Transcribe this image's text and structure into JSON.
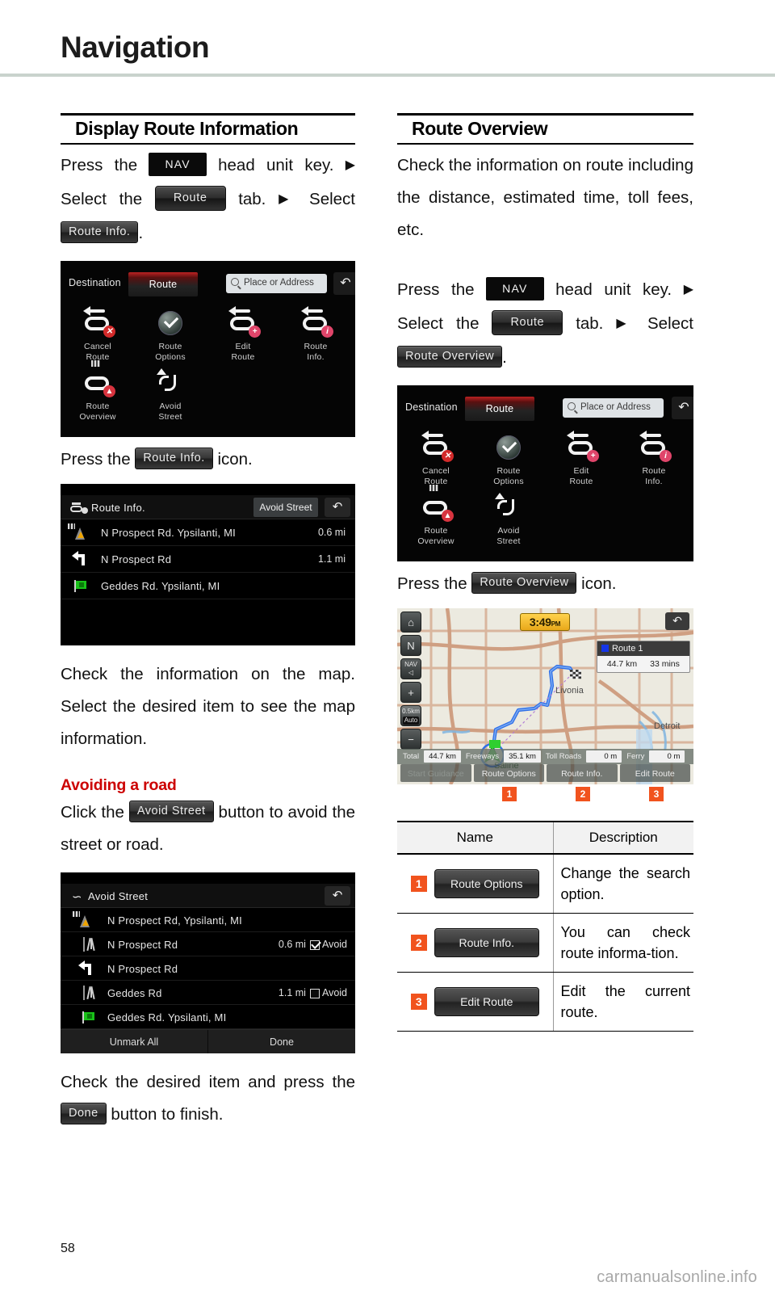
{
  "page": {
    "title": "Navigation",
    "number": "58",
    "watermark": "carmanualsonline.info"
  },
  "left": {
    "heading": "Display Route Information",
    "step1": {
      "pre": "Press the",
      "nav_key": "NAV",
      "mid": "head unit key.",
      "arrow": "▶",
      "select": "Select   the",
      "route_tab": "Route",
      "tab_word": "tab.",
      "arrow2": "▶",
      "select2": "Select",
      "route_info_chip": "Route Info.",
      "period": "."
    },
    "nav_screenshot": {
      "tab_destination": "Destination",
      "tab_route": "Route",
      "search_placeholder": "Place or Address",
      "back_glyph": "↶",
      "items": [
        {
          "label_line1": "Cancel",
          "label_line2": "Route"
        },
        {
          "label_line1": "Route",
          "label_line2": "Options"
        },
        {
          "label_line1": "Edit",
          "label_line2": "Route"
        },
        {
          "label_line1": "Route",
          "label_line2": "Info."
        },
        {
          "label_line1": "Route",
          "label_line2": "Overview"
        },
        {
          "label_line1": "Avoid",
          "label_line2": "Street"
        }
      ]
    },
    "caption1": {
      "pre": "Press the",
      "chip": "Route Info.",
      "post": "icon."
    },
    "route_info_screen": {
      "title": "Route Info.",
      "avoid_button": "Avoid Street",
      "back_glyph": "↶",
      "rows": [
        {
          "icon": "start-road-icon",
          "name": "N Prospect Rd. Ypsilanti, MI",
          "distance": "0.6 mi"
        },
        {
          "icon": "turn-left-icon",
          "name": "N Prospect Rd",
          "distance": "1.1 mi"
        },
        {
          "icon": "finish-flag-icon",
          "name": "Geddes Rd. Ypsilanti, MI",
          "distance": ""
        }
      ]
    },
    "para2": "Check the information on the map. Select the desired item to see the map information.",
    "subhead": "Avoiding a road",
    "para3": {
      "pre": "Click the",
      "chip": "Avoid Street",
      "post": "button to avoid the street or road."
    },
    "avoid_screen": {
      "title": "Avoid Street",
      "back_glyph": "↶",
      "rows": [
        {
          "icon": "start-road-icon",
          "name": "N Prospect Rd, Ypsilanti, MI",
          "distance": "",
          "checkbox": "none",
          "avoid_label": ""
        },
        {
          "icon": "lane-icon",
          "name": "N Prospect Rd",
          "distance": "0.6 mi",
          "checkbox": "checked",
          "avoid_label": "Avoid"
        },
        {
          "icon": "turn-left-icon",
          "name": "N Prospect Rd",
          "distance": "",
          "checkbox": "none",
          "avoid_label": ""
        },
        {
          "icon": "lane-icon",
          "name": "Geddes Rd",
          "distance": "1.1 mi",
          "checkbox": "unchecked",
          "avoid_label": "Avoid"
        },
        {
          "icon": "finish-flag-icon",
          "name": "Geddes Rd. Ypsilanti, MI",
          "distance": "",
          "checkbox": "none",
          "avoid_label": ""
        }
      ],
      "footer": {
        "unmark": "Unmark All",
        "done": "Done"
      }
    },
    "para4": {
      "pre": "Check the desired item and press the",
      "chip": "Done",
      "post": "button to finish."
    }
  },
  "right": {
    "heading": "Route Overview",
    "intro": "Check the information on route including the distance, estimated time, toll fees, etc.",
    "step1": {
      "pre": "Press the",
      "nav_key": "NAV",
      "mid": "head unit key.",
      "arrow": "▶",
      "select": "Select   the",
      "route_tab": "Route",
      "tab_word": "tab.",
      "arrow2": "▶",
      "select2": "Select",
      "route_overview_chip": "Route Overview",
      "period": "."
    },
    "nav_screenshot": {
      "tab_destination": "Destination",
      "tab_route": "Route",
      "search_placeholder": "Place or Address",
      "back_glyph": "↶",
      "items": [
        {
          "label_line1": "Cancel",
          "label_line2": "Route"
        },
        {
          "label_line1": "Route",
          "label_line2": "Options"
        },
        {
          "label_line1": "Edit",
          "label_line2": "Route"
        },
        {
          "label_line1": "Route",
          "label_line2": "Info."
        },
        {
          "label_line1": "Route",
          "label_line2": "Overview"
        },
        {
          "label_line1": "Avoid",
          "label_line2": "Street"
        }
      ]
    },
    "caption1": {
      "pre": "Press the",
      "chip": "Route Overview",
      "post": "icon."
    },
    "map_screen": {
      "home_glyph": "⌂",
      "north_glyph": "N",
      "nav_label": "NAV",
      "volume_glyph": "◁",
      "zoom_in": "+",
      "zoom_out": "−",
      "scale_label": "0.5km",
      "auto_label": "Auto",
      "clock_time": "3:49",
      "clock_ampm": "PM",
      "back_glyph": "↶",
      "route_card": {
        "name": "Route 1",
        "distance": "44.7 km",
        "time": "33 mins"
      },
      "city_labels": [
        "Livonia",
        "Detroit",
        "Saline"
      ],
      "stats": [
        {
          "label": "Total",
          "value": "44.7 km"
        },
        {
          "label": "Freeways",
          "value": "35.1 km"
        },
        {
          "label": "Toll Roads",
          "value": "0 m"
        },
        {
          "label": "Ferry",
          "value": "0 m"
        }
      ],
      "actions": [
        "Start Guidance",
        "Route Options",
        "Route Info.",
        "Edit Route"
      ],
      "badges": [
        "1",
        "2",
        "3"
      ]
    },
    "table": {
      "headers": [
        "Name",
        "Description"
      ],
      "rows": [
        {
          "num": "1",
          "button": "Route Options",
          "description": "Change the search option."
        },
        {
          "num": "2",
          "button": "Route Info.",
          "description": "You can check route informa-tion."
        },
        {
          "num": "3",
          "button": "Edit Route",
          "description": "Edit the current route."
        }
      ]
    }
  }
}
